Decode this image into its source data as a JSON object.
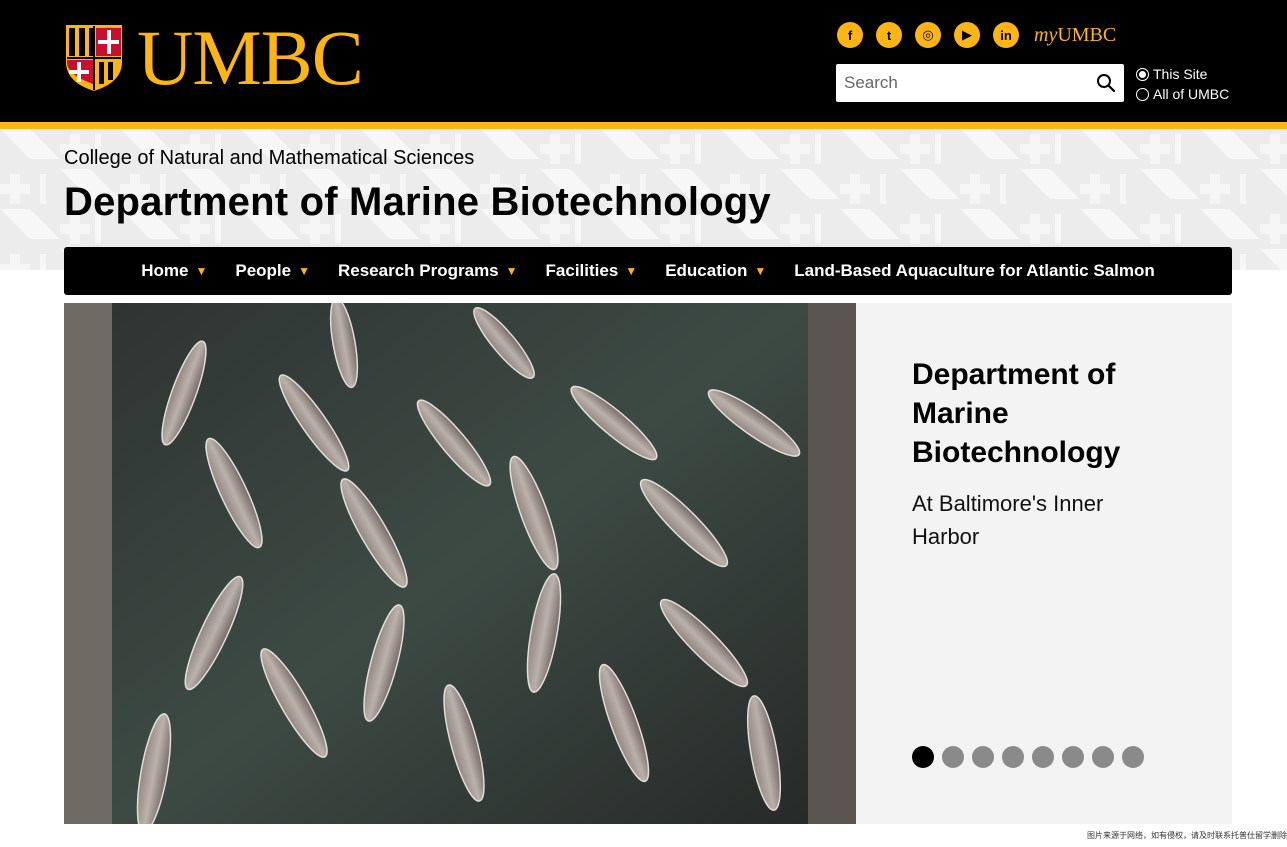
{
  "header": {
    "logo_text": "UMBC",
    "socials": [
      {
        "icon": "facebook-icon",
        "glyph": "f"
      },
      {
        "icon": "twitter-icon",
        "glyph": "t"
      },
      {
        "icon": "instagram-icon",
        "glyph": "◎"
      },
      {
        "icon": "youtube-icon",
        "glyph": "▶"
      },
      {
        "icon": "linkedin-icon",
        "glyph": "in"
      }
    ],
    "myumbc_prefix": "my",
    "myumbc_suffix": "UMBC",
    "search": {
      "placeholder": "Search"
    },
    "scope": {
      "this_site": "This Site",
      "all": "All of UMBC"
    }
  },
  "colors": {
    "gold": "#fdb515",
    "black": "#000000",
    "panel": "#f3f3f3"
  },
  "college": "College of Natural and Mathematical Sciences",
  "department": "Department of Marine Biotechnology",
  "nav": {
    "items": [
      {
        "label": "Home",
        "dropdown": true
      },
      {
        "label": "People",
        "dropdown": true
      },
      {
        "label": "Research Programs",
        "dropdown": true
      },
      {
        "label": "Facilities",
        "dropdown": true
      },
      {
        "label": "Education",
        "dropdown": true
      },
      {
        "label": "Land-Based Aquaculture for Atlantic Salmon",
        "dropdown": false
      }
    ]
  },
  "hero": {
    "title": "Department of Marine Biotechnology",
    "subtitle": "At Baltimore's Inner Harbor",
    "slide_count": 8,
    "active_slide": 1
  },
  "credit": "图片来源于网络，如有侵权，请及时联系托普仕留学删除"
}
